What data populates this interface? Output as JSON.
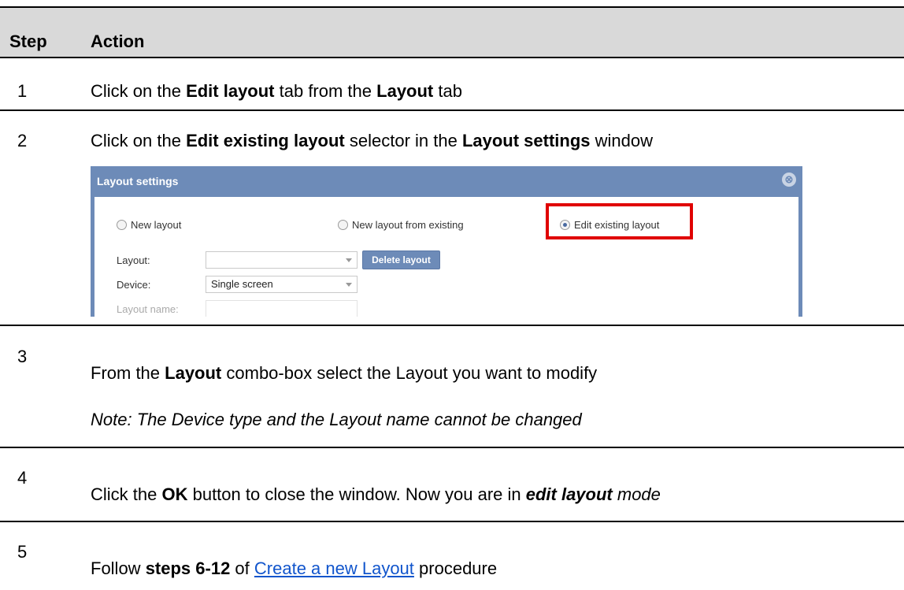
{
  "header": {
    "step": "Step",
    "action": "Action"
  },
  "rows": [
    {
      "num": "1",
      "parts": [
        "Click on the ",
        "Edit layout",
        " tab from the ",
        "Layout",
        " tab"
      ]
    },
    {
      "num": "2",
      "parts": [
        "Click on the ",
        "Edit existing layout",
        " selector in the ",
        "Layout settings",
        " window"
      ]
    },
    {
      "num": "3",
      "parts": [
        "From the ",
        "Layout",
        " combo-box select the Layout you want to modify"
      ],
      "note": "Note: The Device type and the Layout name cannot be changed"
    },
    {
      "num": "4",
      "parts": [
        "Click the ",
        "OK",
        " button to close the window. Now you are in ",
        "edit layout",
        " mode"
      ]
    },
    {
      "num": "5",
      "parts": [
        "Follow ",
        "steps 6-12",
        " of ",
        "Create a new Layout",
        " procedure"
      ]
    }
  ],
  "dialog": {
    "title": "Layout settings",
    "close_icon": "⊗",
    "radios": {
      "new_layout": "New layout",
      "new_from_existing": "New layout from existing",
      "edit_existing": "Edit existing layout",
      "selected": "edit_existing"
    },
    "fields": {
      "layout_label": "Layout:",
      "layout_value": "",
      "delete_button": "Delete layout",
      "device_label": "Device:",
      "device_value": "Single screen",
      "layout_name_label": "Layout name:",
      "layout_name_value": ""
    }
  },
  "colors": {
    "header_band": "#d9d9d9",
    "dialog_blue": "#6d8bb8",
    "highlight_red": "#e00000",
    "link_blue": "#1155cc"
  }
}
